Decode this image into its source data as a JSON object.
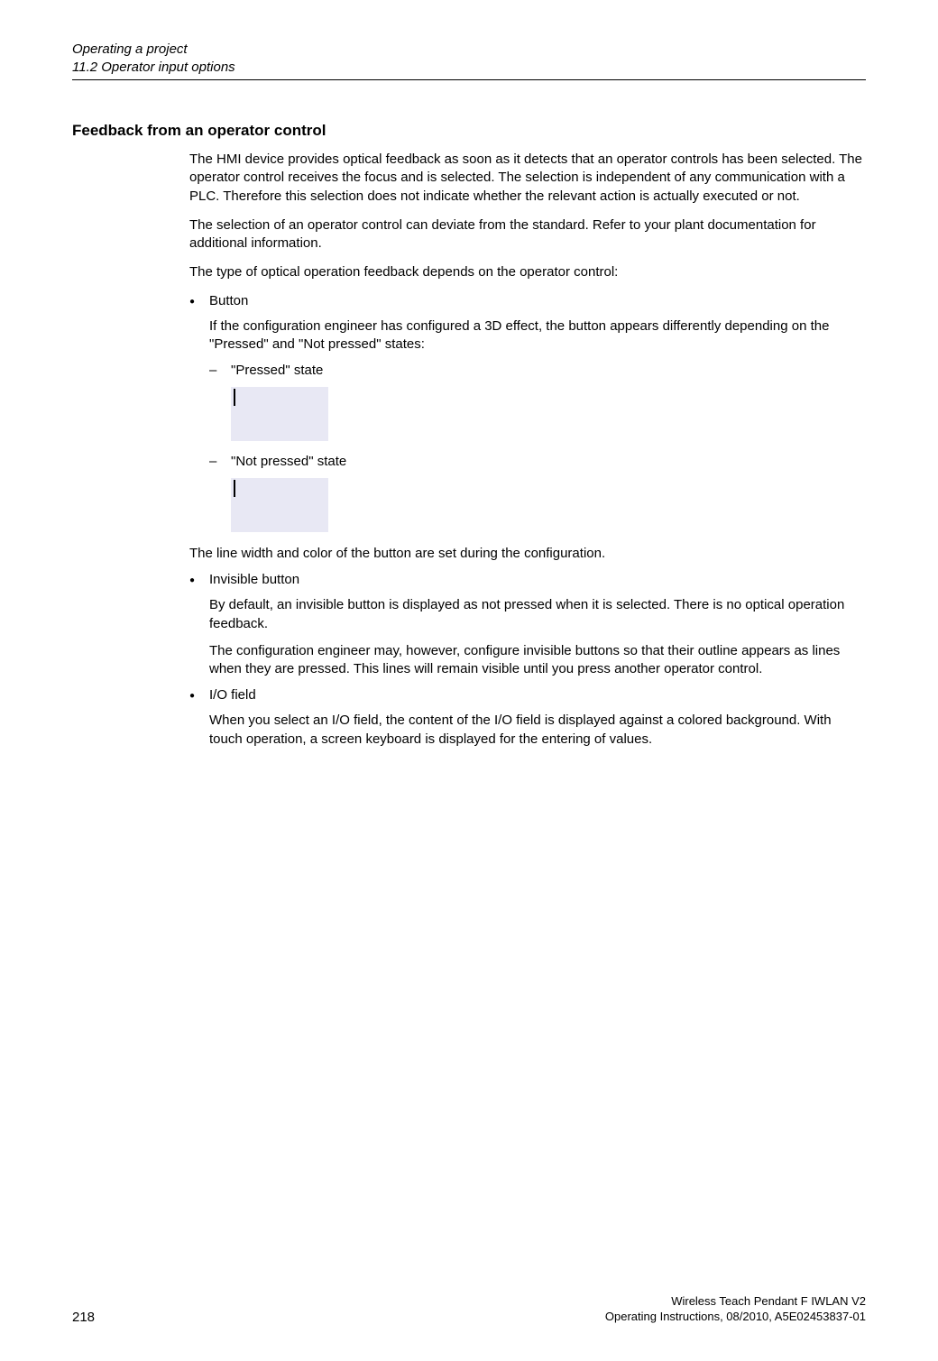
{
  "header": {
    "line1": "Operating a project",
    "line2": "11.2 Operator input options"
  },
  "section": {
    "title": "Feedback from an operator control",
    "p1": "The HMI device provides optical feedback as soon as it detects that an operator controls has been selected. The operator control receives the focus and is selected. The selection is independent of any communication with a PLC. Therefore this selection does not indicate whether the relevant action is actually executed or not.",
    "p2": "The selection of an operator control can deviate from the standard. Refer to your plant documentation for additional information.",
    "p3": "The type of optical operation feedback depends on the operator control:",
    "bullets": [
      {
        "label": "Button",
        "body": "If the configuration engineer has configured a 3D effect, the button appears differently depending on the \"Pressed\" and \"Not pressed\" states:",
        "sub": [
          {
            "text": "\"Pressed\" state"
          },
          {
            "text": "\"Not pressed\" state"
          }
        ],
        "after": "The line width and color of the button are set during the configuration."
      },
      {
        "label": "Invisible button",
        "body1": "By default, an invisible button is displayed as not pressed when it is selected. There is no optical operation feedback.",
        "body2": "The configuration engineer may, however, configure invisible buttons so that their outline appears as lines when they are pressed. This lines will remain visible until you press another operator control."
      },
      {
        "label": "I/O field",
        "body": "When you select an I/O field, the content of the I/O field is displayed against a colored background. With touch operation, a screen keyboard is displayed for the entering of values."
      }
    ]
  },
  "footer": {
    "page": "218",
    "right1": "Wireless Teach Pendant F IWLAN V2",
    "right2": "Operating Instructions, 08/2010, A5E02453837-01"
  }
}
